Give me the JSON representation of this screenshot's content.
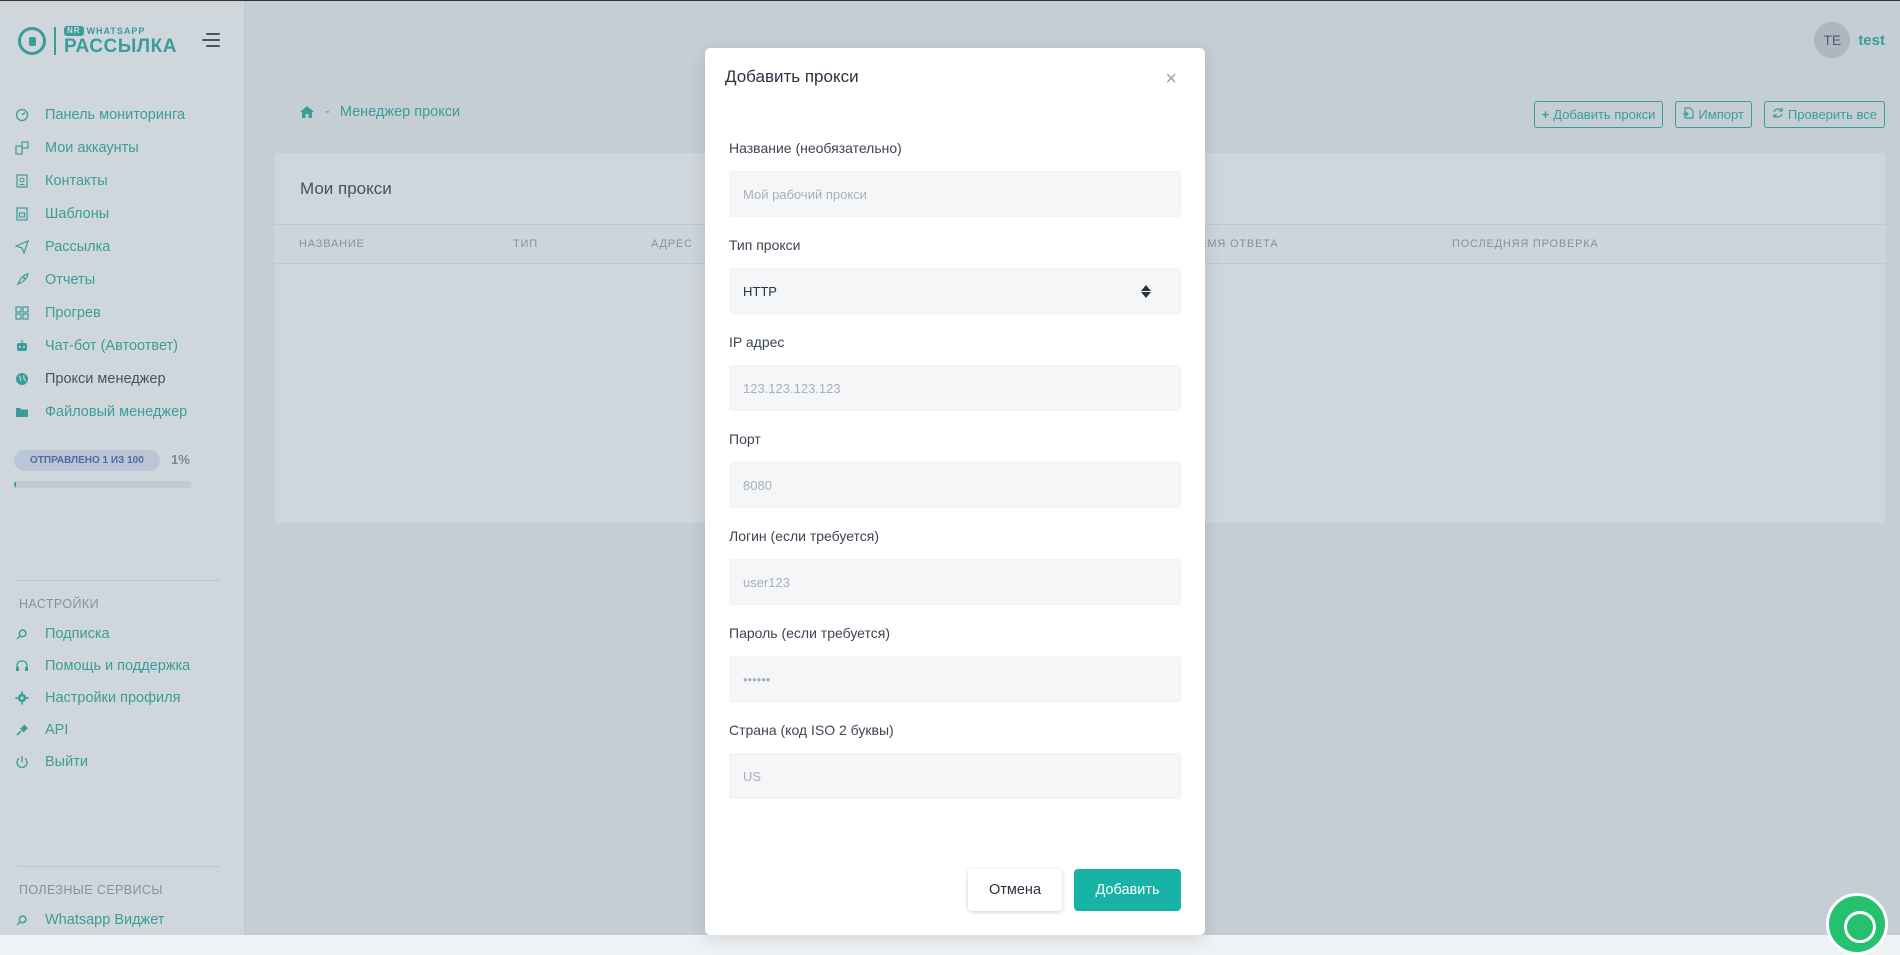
{
  "brand": {
    "logo_top": "WHATSAPP",
    "logo_badge": "NR",
    "logo_main": "РАССЫЛКА"
  },
  "sidebar": {
    "items": [
      {
        "label": "Панель мониторинга",
        "icon": "gauge-icon"
      },
      {
        "label": "Мои аккаунты",
        "icon": "devices-icon"
      },
      {
        "label": "Контакты",
        "icon": "contact-book-icon"
      },
      {
        "label": "Шаблоны",
        "icon": "template-icon"
      },
      {
        "label": "Рассылка",
        "icon": "paper-plane-icon"
      },
      {
        "label": "Отчеты",
        "icon": "rocket-icon"
      },
      {
        "label": "Прогрев",
        "icon": "apps-icon"
      },
      {
        "label": "Чат-бот (Автоответ)",
        "icon": "robot-icon"
      },
      {
        "label": "Прокси менеджер",
        "icon": "globe-icon"
      },
      {
        "label": "Файловый менеджер",
        "icon": "folder-icon"
      }
    ],
    "usage": {
      "label": "ОТПРАВЛЕНО 1 ИЗ 100",
      "percent_text": "1%",
      "percent": 1
    },
    "settings_title": "НАСТРОЙКИ",
    "settings_items": [
      {
        "label": "Подписка",
        "icon": "subscription-icon"
      },
      {
        "label": "Помощь и поддержка",
        "icon": "headset-icon"
      },
      {
        "label": "Настройки профиля",
        "icon": "gear-icon"
      },
      {
        "label": "API",
        "icon": "api-plug-icon"
      },
      {
        "label": "Выйти",
        "icon": "power-icon"
      }
    ],
    "services_title": "ПОЛЕЗНЫЕ СЕРВИСЫ",
    "services_items": [
      {
        "label": "Whatsapp Виджет",
        "icon": "widget-icon"
      }
    ]
  },
  "header": {
    "avatar_initials": "TE",
    "username": "test"
  },
  "breadcrumb": {
    "separator": "-",
    "current": "Менеджер прокси"
  },
  "toolbar": {
    "add_label": "Добавить прокси",
    "import_label": "Импорт",
    "check_all_label": "Проверить все"
  },
  "card": {
    "title": "Мои прокси",
    "columns": [
      "НАЗВАНИЕ",
      "ТИП",
      "АДРЕС",
      "ВРЕМЯ ОТВЕТА",
      "ПОСЛЕДНЯЯ ПРОВЕРКА"
    ]
  },
  "modal": {
    "title": "Добавить прокси",
    "close_symbol": "×",
    "fields": {
      "name": {
        "label": "Название (необязательно)",
        "placeholder": "Мой рабочий прокси"
      },
      "type": {
        "label": "Тип прокси",
        "value": "HTTP"
      },
      "ip": {
        "label": "IP адрес",
        "placeholder": "123.123.123.123"
      },
      "port": {
        "label": "Порт",
        "placeholder": "8080"
      },
      "login": {
        "label": "Логин (если требуется)",
        "placeholder": "user123"
      },
      "password": {
        "label": "Пароль (если требуется)",
        "placeholder": "••••••"
      },
      "country": {
        "label": "Страна (код ISO 2 буквы)",
        "placeholder": "US"
      }
    },
    "cancel_label": "Отмена",
    "submit_label": "Добавить"
  },
  "colors": {
    "accent": "#1aa79a",
    "primary_button": "#17b3a7",
    "text_dark": "#2a3340"
  }
}
